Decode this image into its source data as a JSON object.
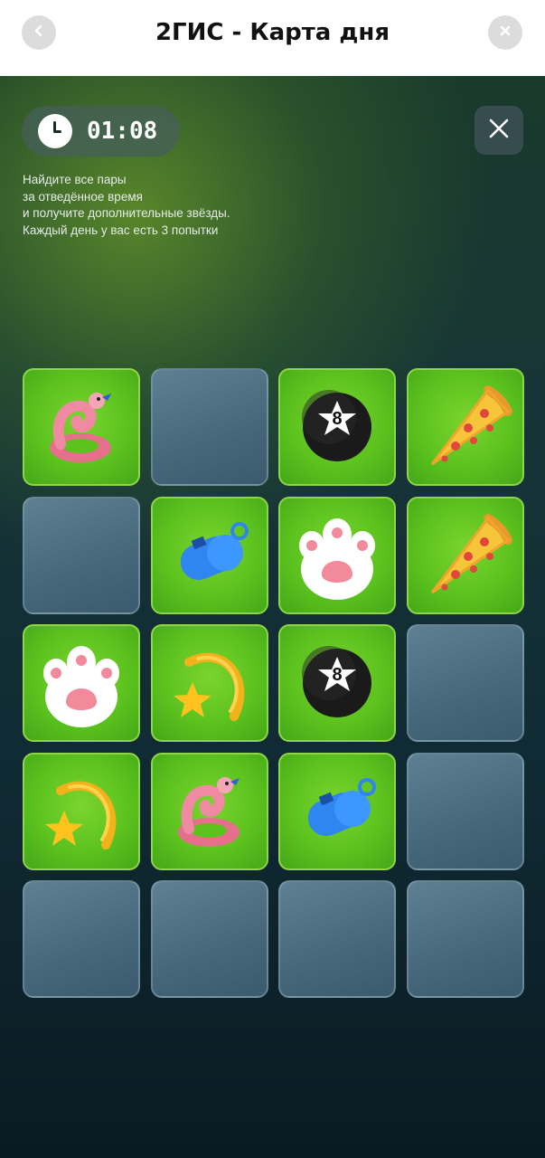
{
  "header": {
    "title": "2ГИС - Карта дня",
    "back_icon": "chevron-left-icon",
    "close_icon": "close-icon"
  },
  "game": {
    "timer": "01:08",
    "timer_icon": "clock-icon",
    "close_icon": "close-icon",
    "instructions": [
      "Найдите все пары",
      "за отведённое время",
      "и получите дополнительные звёзды.",
      "Каждый день у вас есть 3 попытки"
    ],
    "board": {
      "rows": 5,
      "cols": 4,
      "cards": [
        [
          "flamingo-float",
          "hidden",
          "billiard-ball-8",
          "pizza-slice"
        ],
        [
          "hidden",
          "whistle",
          "paw",
          "pizza-slice"
        ],
        [
          "paw",
          "shooting-star",
          "billiard-ball-8",
          "hidden"
        ],
        [
          "shooting-star",
          "flamingo-float",
          "whistle",
          "hidden"
        ],
        [
          "hidden",
          "hidden",
          "hidden",
          "hidden"
        ]
      ],
      "ball_number": "8"
    }
  },
  "colors": {
    "card_open": "#5cc21e",
    "card_hidden": "#4b6b80",
    "header_bg": "#ffffff"
  }
}
